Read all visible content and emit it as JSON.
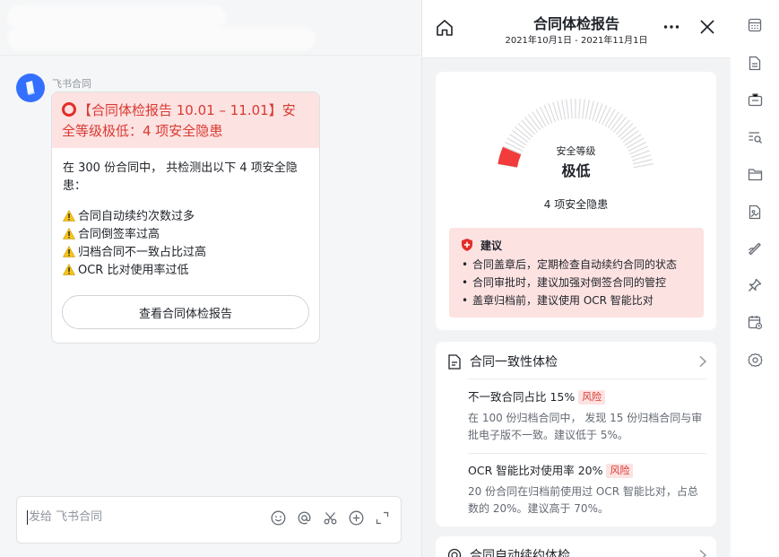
{
  "chat": {
    "sender": "飞书合同",
    "card": {
      "title": "【合同体检报告 10.01 – 11.01】安全等级极低：4 项安全隐患",
      "intro": "在 300 份合同中， 共检测出以下 4 项安全隐患：",
      "issues": [
        "合同自动续约次数过多",
        "合同倒签率过高",
        "归档合同不一致占比过高",
        "OCR 比对使用率过低"
      ],
      "button": "查看合同体检报告"
    },
    "composer": {
      "placeholder": "发给 飞书合同",
      "icons": [
        "emoji-icon",
        "mention-icon",
        "scissors-icon",
        "plus-circle-icon",
        "expand-icon"
      ]
    }
  },
  "panel": {
    "title": "合同体检报告",
    "date_range": "2021年10月1日 - 2021年11月1日",
    "score": {
      "label": "安全等级",
      "value": "极低",
      "risk_count": "4 项安全隐患",
      "gauge_level": 0.08,
      "danger_color": "#f23b3b"
    },
    "advice": {
      "title": "建议",
      "items": [
        "合同盖章后，定期检查自动续约合同的状态",
        "合同审批时，建议加强对倒签合同的管控",
        "盖章归档前，建议使用 OCR 智能比对"
      ]
    },
    "check1": {
      "title": "合同一致性体检",
      "items": [
        {
          "title": "不一致合同占比 15%",
          "tag": "风险",
          "desc": "在 100 份归档合同中， 发现 15 份归档合同与审批电子版不一致。建议低于 5%。"
        },
        {
          "title": "OCR 智能比对使用率 20%",
          "tag": "风险",
          "desc": "20 份合同在归档前使用过 OCR 智能比对，占总数的 20%。建议高于 70%。"
        }
      ]
    },
    "check2": {
      "title": "合同自动续约体检"
    }
  },
  "rail": {
    "icons": [
      "calculator-icon",
      "document-icon",
      "briefcase-icon",
      "search-list-icon",
      "folder-icon",
      "image-file-icon",
      "sign-icon",
      "pin-icon",
      "calendar-clock-icon",
      "settings-icon"
    ]
  },
  "colors": {
    "accent": "#3370ff",
    "danger": "#d83931",
    "danger_bg": "#fde2e2"
  }
}
